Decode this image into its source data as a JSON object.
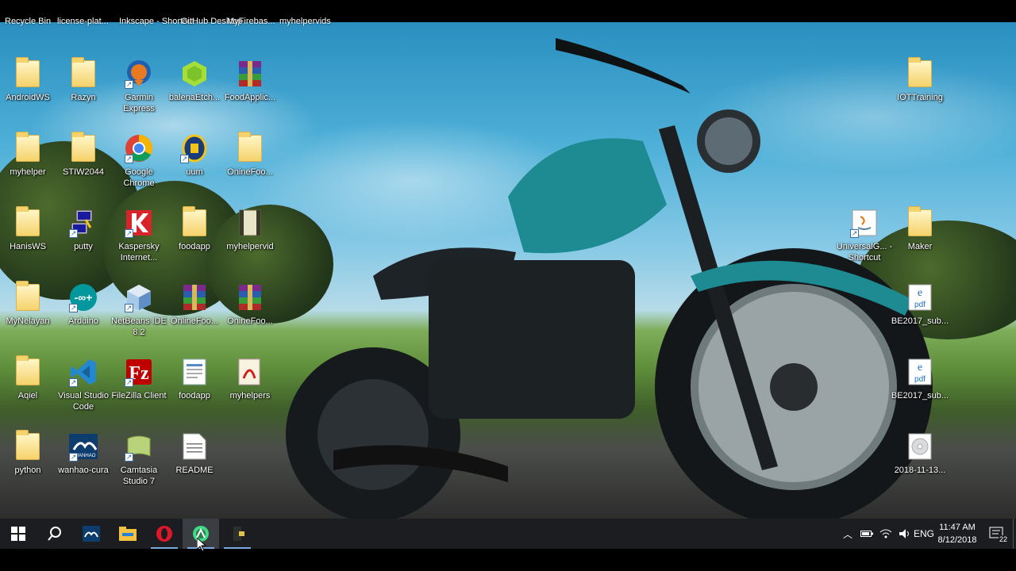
{
  "top_row_labels": [
    "Recycle Bin",
    "license-plat...",
    "Inkscape - Shortcut",
    "GitHub Desktop",
    "MyFirebas...",
    "myhelpervids"
  ],
  "icons": [
    {
      "label": "AndroidWS",
      "icon": "folder-icon"
    },
    {
      "label": "Razyn",
      "icon": "folder-icon"
    },
    {
      "label": "Garmin Express",
      "icon": "garmin-icon"
    },
    {
      "label": "balenaEtch...",
      "icon": "balena-etcher-icon"
    },
    {
      "label": "FoodApplic...",
      "icon": "winrar-icon"
    },
    {
      "label": "myhelper",
      "icon": "folder-icon"
    },
    {
      "label": "STIW2044",
      "icon": "folder-icon"
    },
    {
      "label": "Google Chrome",
      "icon": "chrome-icon"
    },
    {
      "label": "uum",
      "icon": "uum-logo-icon"
    },
    {
      "label": "OnineFoo...",
      "icon": "folder-icon"
    },
    {
      "label": "HanisWS",
      "icon": "folder-icon"
    },
    {
      "label": "putty",
      "icon": "putty-icon"
    },
    {
      "label": "Kaspersky Internet...",
      "icon": "kaspersky-icon"
    },
    {
      "label": "foodapp",
      "icon": "folder-icon"
    },
    {
      "label": "myhelpervid",
      "icon": "video-icon"
    },
    {
      "label": "MyNelayan",
      "icon": "folder-icon"
    },
    {
      "label": "Arduino",
      "icon": "arduino-icon"
    },
    {
      "label": "NetBeans IDE 8.2",
      "icon": "netbeans-icon"
    },
    {
      "label": "OnlineFoo...",
      "icon": "winrar-icon"
    },
    {
      "label": "OnineFoo...",
      "icon": "winrar-icon"
    },
    {
      "label": "Aqiel",
      "icon": "folder-icon"
    },
    {
      "label": "Visual Studio Code",
      "icon": "vscode-icon"
    },
    {
      "label": "FileZilla Client",
      "icon": "filezilla-icon"
    },
    {
      "label": "foodapp",
      "icon": "document-icon"
    },
    {
      "label": "myhelpers",
      "icon": "pdf-icon"
    },
    {
      "label": "python",
      "icon": "folder-icon"
    },
    {
      "label": "wanhao-cura",
      "icon": "wanhao-icon"
    },
    {
      "label": "Camtasia Studio 7",
      "icon": "camtasia-icon"
    },
    {
      "label": "README",
      "icon": "text-file-icon"
    },
    {
      "label": "IOTTraining",
      "icon": "folder-icon"
    },
    {
      "label": "UniversalG... - Shortcut",
      "icon": "java-icon"
    },
    {
      "label": "Maker",
      "icon": "folder-icon"
    },
    {
      "label": "BE2017_sub...",
      "icon": "pdf-edge-icon"
    },
    {
      "label": "BE2017_sub...",
      "icon": "pdf-edge-icon"
    },
    {
      "label": "2018-11-13...",
      "icon": "disc-image-icon"
    }
  ],
  "taskbar": {
    "apps": [
      "start-icon",
      "search-icon",
      "wanhao-cura-taskbar-icon",
      "file-explorer-icon",
      "opera-icon",
      "android-studio-icon",
      "app-window-icon"
    ],
    "tray": {
      "language": "ENG",
      "time": "11:47 AM",
      "date": "8/12/2018",
      "notification_count": "22"
    }
  }
}
